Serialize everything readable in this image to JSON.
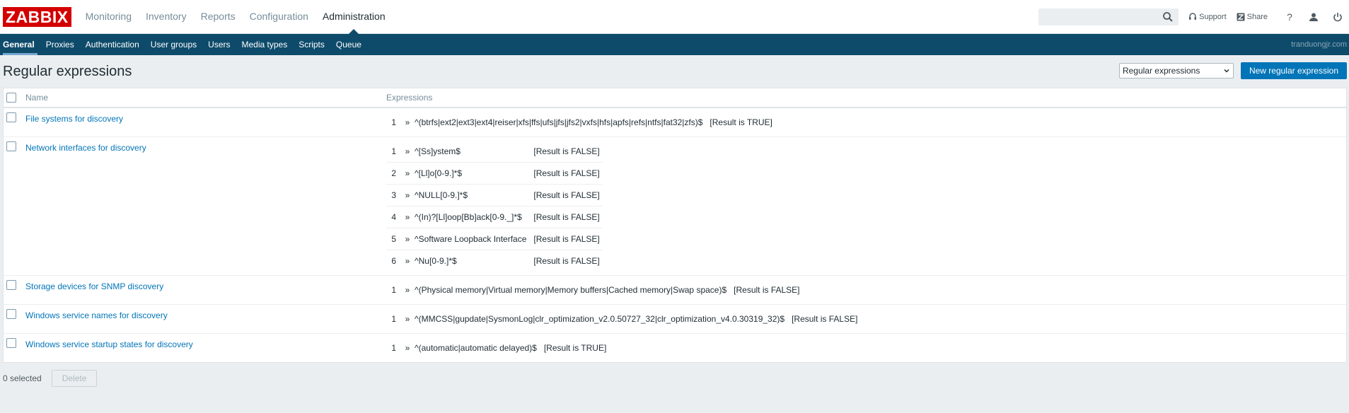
{
  "logo": "ZABBIX",
  "main_nav": [
    {
      "label": "Monitoring",
      "active": false
    },
    {
      "label": "Inventory",
      "active": false
    },
    {
      "label": "Reports",
      "active": false
    },
    {
      "label": "Configuration",
      "active": false
    },
    {
      "label": "Administration",
      "active": true
    }
  ],
  "header": {
    "search_value": "",
    "support_label": "Support",
    "share_label": "Share",
    "help_label": "?"
  },
  "sub_nav": [
    {
      "label": "General",
      "active": true
    },
    {
      "label": "Proxies",
      "active": false
    },
    {
      "label": "Authentication",
      "active": false
    },
    {
      "label": "User groups",
      "active": false
    },
    {
      "label": "Users",
      "active": false
    },
    {
      "label": "Media types",
      "active": false
    },
    {
      "label": "Scripts",
      "active": false
    },
    {
      "label": "Queue",
      "active": false
    }
  ],
  "server_name": "tranduongjr.com",
  "page": {
    "title": "Regular expressions",
    "dropdown_value": "Regular expressions",
    "new_button": "New regular expression"
  },
  "table": {
    "columns": {
      "name": "Name",
      "expressions": "Expressions"
    },
    "rows": [
      {
        "name": "File systems for discovery",
        "expressions": [
          {
            "num": "1",
            "arrow": "»",
            "text": "^(btrfs|ext2|ext3|ext4|reiser|xfs|ffs|ufs|jfs|jfs2|vxfs|hfs|apfs|refs|ntfs|fat32|zfs)$",
            "result": "[Result is TRUE]"
          }
        ]
      },
      {
        "name": "Network interfaces for discovery",
        "expressions": [
          {
            "num": "1",
            "arrow": "»",
            "text": "^[Ss]ystem$",
            "result": "[Result is FALSE]"
          },
          {
            "num": "2",
            "arrow": "»",
            "text": "^[Ll]o[0-9.]*$",
            "result": "[Result is FALSE]"
          },
          {
            "num": "3",
            "arrow": "»",
            "text": "^NULL[0-9.]*$",
            "result": "[Result is FALSE]"
          },
          {
            "num": "4",
            "arrow": "»",
            "text": "^(In)?[Ll]oop[Bb]ack[0-9._]*$",
            "result": "[Result is FALSE]"
          },
          {
            "num": "5",
            "arrow": "»",
            "text": "^Software Loopback Interface",
            "result": "[Result is FALSE]"
          },
          {
            "num": "6",
            "arrow": "»",
            "text": "^Nu[0-9.]*$",
            "result": "[Result is FALSE]"
          }
        ]
      },
      {
        "name": "Storage devices for SNMP discovery",
        "expressions": [
          {
            "num": "1",
            "arrow": "»",
            "text": "^(Physical memory|Virtual memory|Memory buffers|Cached memory|Swap space)$",
            "result": "[Result is FALSE]"
          }
        ]
      },
      {
        "name": "Windows service names for discovery",
        "expressions": [
          {
            "num": "1",
            "arrow": "»",
            "text": "^(MMCSS|gupdate|SysmonLog|clr_optimization_v2.0.50727_32|clr_optimization_v4.0.30319_32)$",
            "result": "[Result is FALSE]"
          }
        ]
      },
      {
        "name": "Windows service startup states for discovery",
        "expressions": [
          {
            "num": "1",
            "arrow": "»",
            "text": "^(automatic|automatic delayed)$",
            "result": "[Result is TRUE]"
          }
        ]
      }
    ]
  },
  "footer": {
    "selected_count": "0 selected",
    "delete_label": "Delete"
  }
}
